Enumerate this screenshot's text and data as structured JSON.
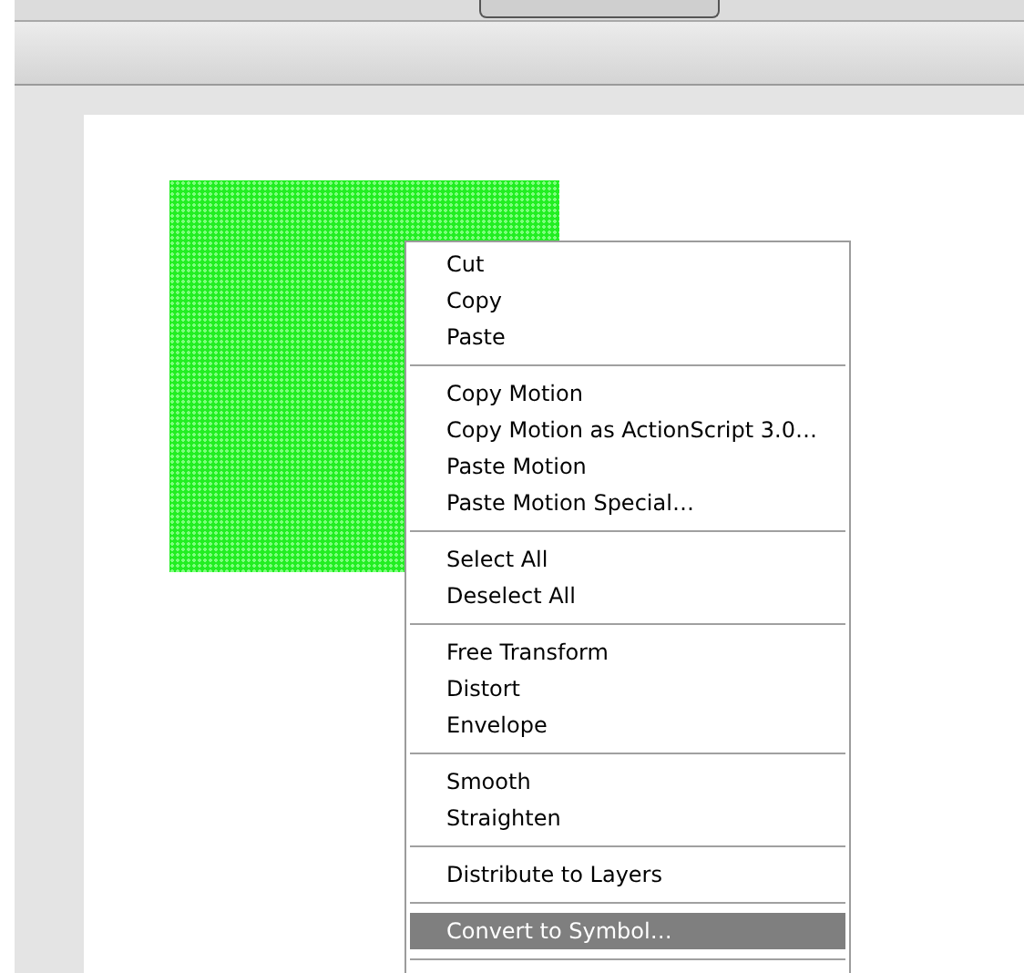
{
  "context_menu": {
    "groups": [
      [
        {
          "label": "Cut",
          "selected": false
        },
        {
          "label": "Copy",
          "selected": false
        },
        {
          "label": "Paste",
          "selected": false
        }
      ],
      [
        {
          "label": "Copy Motion",
          "selected": false
        },
        {
          "label": "Copy Motion as ActionScript 3.0…",
          "selected": false
        },
        {
          "label": "Paste Motion",
          "selected": false
        },
        {
          "label": "Paste Motion Special…",
          "selected": false
        }
      ],
      [
        {
          "label": "Select All",
          "selected": false
        },
        {
          "label": "Deselect All",
          "selected": false
        }
      ],
      [
        {
          "label": "Free Transform",
          "selected": false
        },
        {
          "label": "Distort",
          "selected": false
        },
        {
          "label": "Envelope",
          "selected": false
        }
      ],
      [
        {
          "label": "Smooth",
          "selected": false
        },
        {
          "label": "Straighten",
          "selected": false
        }
      ],
      [
        {
          "label": "Distribute to Layers",
          "selected": false
        }
      ],
      [
        {
          "label": "Convert to Symbol…",
          "selected": true
        }
      ]
    ]
  }
}
